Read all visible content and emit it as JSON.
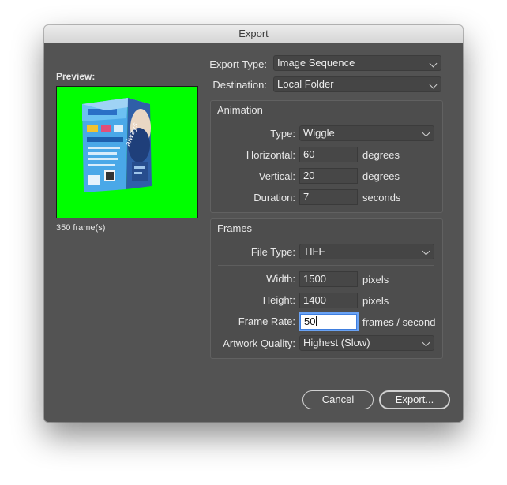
{
  "window": {
    "title": "Export"
  },
  "preview": {
    "label": "Preview:",
    "frames": "350 frame(s)",
    "product_text": "always"
  },
  "export": {
    "type_label": "Export Type:",
    "type_value": "Image Sequence",
    "dest_label": "Destination:",
    "dest_value": "Local Folder"
  },
  "animation": {
    "title": "Animation",
    "type_label": "Type:",
    "type_value": "Wiggle",
    "horizontal_label": "Horizontal:",
    "horizontal_value": "60",
    "horizontal_unit": "degrees",
    "vertical_label": "Vertical:",
    "vertical_value": "20",
    "vertical_unit": "degrees",
    "duration_label": "Duration:",
    "duration_value": "7",
    "duration_unit": "seconds"
  },
  "frames": {
    "title": "Frames",
    "filetype_label": "File Type:",
    "filetype_value": "TIFF",
    "width_label": "Width:",
    "width_value": "1500",
    "width_unit": "pixels",
    "height_label": "Height:",
    "height_value": "1400",
    "height_unit": "pixels",
    "framerate_label": "Frame Rate:",
    "framerate_value": "50",
    "framerate_unit": "frames / second",
    "quality_label": "Artwork Quality:",
    "quality_value": "Highest (Slow)"
  },
  "buttons": {
    "cancel": "Cancel",
    "export": "Export..."
  },
  "colors": {
    "dialog_bg": "#535353",
    "preview_bg": "#00ff00",
    "focus_ring": "#6aa3f5"
  }
}
